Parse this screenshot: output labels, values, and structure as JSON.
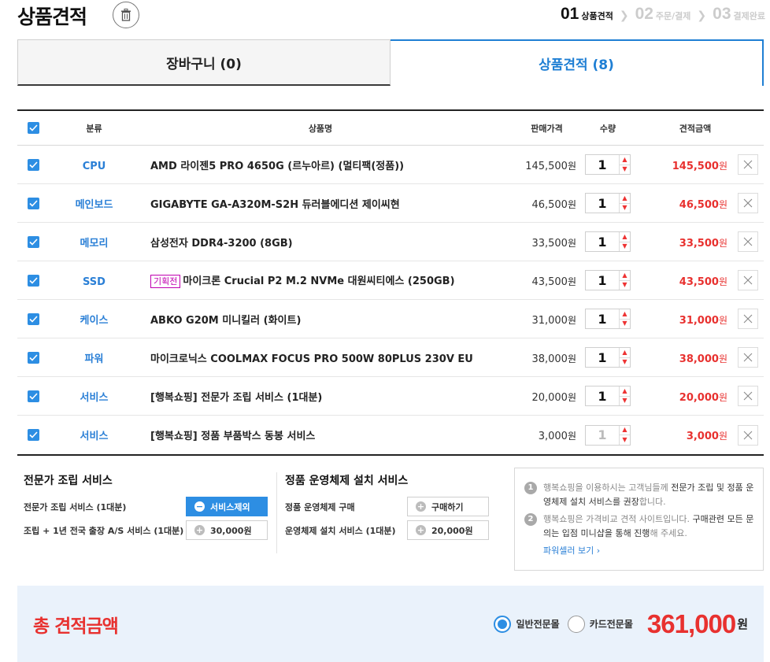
{
  "header": {
    "title": "상품견적",
    "steps": [
      {
        "num": "01",
        "label": "상품견적"
      },
      {
        "num": "02",
        "label": "주문/결제"
      },
      {
        "num": "03",
        "label": "결제완료"
      }
    ]
  },
  "tabs": {
    "cart": "장바구니 (0)",
    "quote": "상품견적 (8)"
  },
  "table": {
    "headers": {
      "category": "분류",
      "name": "상품명",
      "price": "판매가격",
      "qty": "수량",
      "total": "견적금액"
    },
    "won": "원",
    "rows": [
      {
        "category": "CPU",
        "badge": "",
        "name": "AMD 라이젠5 PRO 4650G (르누아르) (멀티팩(정품))",
        "price": "145,500",
        "qty": "1",
        "total": "145,500"
      },
      {
        "category": "메인보드",
        "badge": "",
        "name": "GIGABYTE GA-A320M-S2H 듀러블에디션 제이씨현",
        "price": "46,500",
        "qty": "1",
        "total": "46,500"
      },
      {
        "category": "메모리",
        "badge": "",
        "name": "삼성전자 DDR4-3200 (8GB)",
        "price": "33,500",
        "qty": "1",
        "total": "33,500"
      },
      {
        "category": "SSD",
        "badge": "기획전",
        "name": "마이크론 Crucial P2 M.2 NVMe 대원씨티에스 (250GB)",
        "price": "43,500",
        "qty": "1",
        "total": "43,500"
      },
      {
        "category": "케이스",
        "badge": "",
        "name": "ABKO G20M 미니킬러 (화이트)",
        "price": "31,000",
        "qty": "1",
        "total": "31,000"
      },
      {
        "category": "파워",
        "badge": "",
        "name": "마이크로닉스 COOLMAX FOCUS PRO 500W 80PLUS 230V EU",
        "price": "38,000",
        "qty": "1",
        "total": "38,000"
      },
      {
        "category": "서비스",
        "badge": "",
        "name": "[행복쇼핑] 전문가 조립 서비스 (1대분)",
        "price": "20,000",
        "qty": "1",
        "total": "20,000"
      },
      {
        "category": "서비스",
        "badge": "",
        "name": "[행복쇼핑] 정품 부품박스 동봉 서비스",
        "price": "3,000",
        "qty": "1",
        "total": "3,000"
      }
    ]
  },
  "services": {
    "assembly": {
      "title": "전문가 조립 서비스",
      "row1_label": "전문가 조립 서비스 (1대분)",
      "row1_btn": "서비스제외",
      "row2_label": "조립 + 1년 전국 출장 A/S 서비스 (1대분)",
      "row2_btn": "30,000원"
    },
    "os": {
      "title": "정품 운영체제 설치 서비스",
      "row1_label": "정품 운영체제 구매",
      "row1_btn": "구매하기",
      "row2_label": "운영체제 설치 서비스 (1대분)",
      "row2_btn": "20,000원"
    }
  },
  "notice": {
    "item1_pre": "행복쇼핑을 이용하시는 고객님들께 ",
    "item1_bold": "전문가 조립 및 정품 운영체제 설치 서비스를 권장",
    "item1_post": "합니다.",
    "item2_pre": "행복쇼핑은 가격비교 견적 사이트입니다. ",
    "item2_bold": "구매관련 모든 문의는 입점 미니샵을 통해 진행",
    "item2_post": "해 주세요.",
    "link": "파워셀러 보기 ›"
  },
  "total_bar": {
    "title": "총 견적금액",
    "radio_general": "일반전문몰",
    "radio_card": "카드전문몰",
    "amount": "361,000",
    "won": "원"
  },
  "colors": {
    "accent": "#2d8ee3",
    "price_red": "#e8312f",
    "category_blue": "#2a7fd6"
  }
}
